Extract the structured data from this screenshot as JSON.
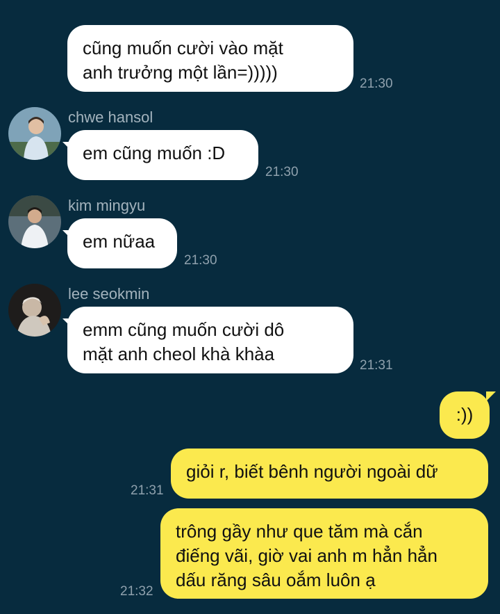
{
  "messages": [
    {
      "sender": "",
      "text_lines": [
        "cũng muốn cười vào mặt",
        "anh trưởng một lần=)))))"
      ],
      "time": "21:30",
      "direction": "incoming"
    },
    {
      "sender": "chwe hansol",
      "avatar_icon": "person-photo-icon",
      "text_lines": [
        "em cũng muốn :D"
      ],
      "time": "21:30",
      "direction": "incoming"
    },
    {
      "sender": "kim mingyu",
      "avatar_icon": "person-photo-icon",
      "text_lines": [
        "em nữaa"
      ],
      "time": "21:30",
      "direction": "incoming"
    },
    {
      "sender": "lee seokmin",
      "avatar_icon": "person-photo-icon",
      "text_lines": [
        "emm cũng muốn cười dô",
        "mặt anh cheol khà khàa"
      ],
      "time": "21:31",
      "direction": "incoming"
    },
    {
      "sender": "",
      "text_lines": [
        ":))"
      ],
      "time": "",
      "direction": "outgoing"
    },
    {
      "sender": "",
      "text_lines": [
        "giỏi r, biết bênh người ngoài dữ"
      ],
      "time": "21:31",
      "direction": "outgoing"
    },
    {
      "sender": "",
      "text_lines": [
        "trông gầy như que tăm mà cắn",
        "điếng vãi, giờ vai anh m hẳn hẳn",
        "dấu răng sâu oắm luôn ạ"
      ],
      "time": "21:32",
      "direction": "outgoing"
    }
  ],
  "colors": {
    "background": "#072b3e",
    "incoming_bubble": "#ffffff",
    "outgoing_bubble": "#fbe94e",
    "timestamp": "#8fa1ad",
    "sender_name": "#a3b3bd"
  }
}
